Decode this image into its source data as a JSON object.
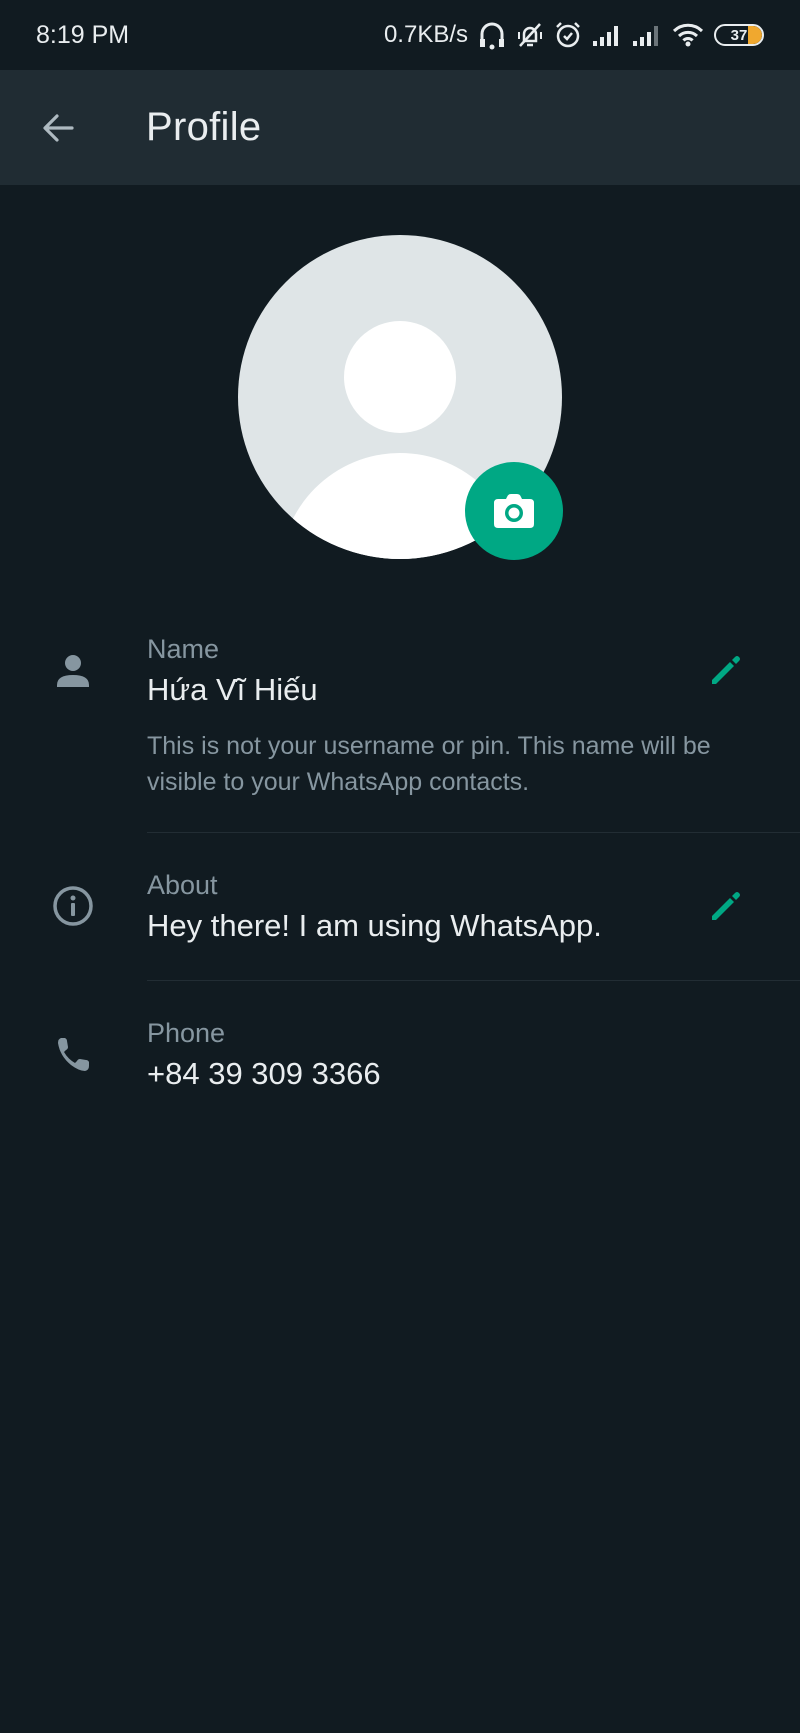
{
  "status_bar": {
    "time": "8:19 PM",
    "net_speed": "0.7KB/s",
    "icons": [
      "headset-icon",
      "vibrate-off-icon",
      "alarm-icon",
      "signal-icon",
      "signal-icon-2",
      "wifi-icon",
      "battery-icon"
    ],
    "battery_level": "37",
    "battery_color": "#f0a82f"
  },
  "app_bar": {
    "back_icon": "arrow-left-icon",
    "title": "Profile"
  },
  "avatar": {
    "placeholder_icon": "default-avatar-icon",
    "camera_icon": "camera-icon",
    "accent": "#00a884"
  },
  "fields": {
    "name": {
      "icon": "person-icon",
      "label": "Name",
      "value": "Hứa Vĩ Hiếu",
      "help": "This is not your username or pin. This name will be visible to your WhatsApp contacts.",
      "edit_icon": "pencil-icon"
    },
    "about": {
      "icon": "info-icon",
      "label": "About",
      "value": "Hey there! I am using WhatsApp.",
      "edit_icon": "pencil-icon"
    },
    "phone": {
      "icon": "phone-icon",
      "label": "Phone",
      "value": "+84 39 309 3366"
    }
  },
  "colors": {
    "background": "#111b21",
    "app_bar": "#202c33",
    "accent": "#00a884",
    "secondary_text": "#8696a0",
    "primary_text": "#e9edef"
  }
}
